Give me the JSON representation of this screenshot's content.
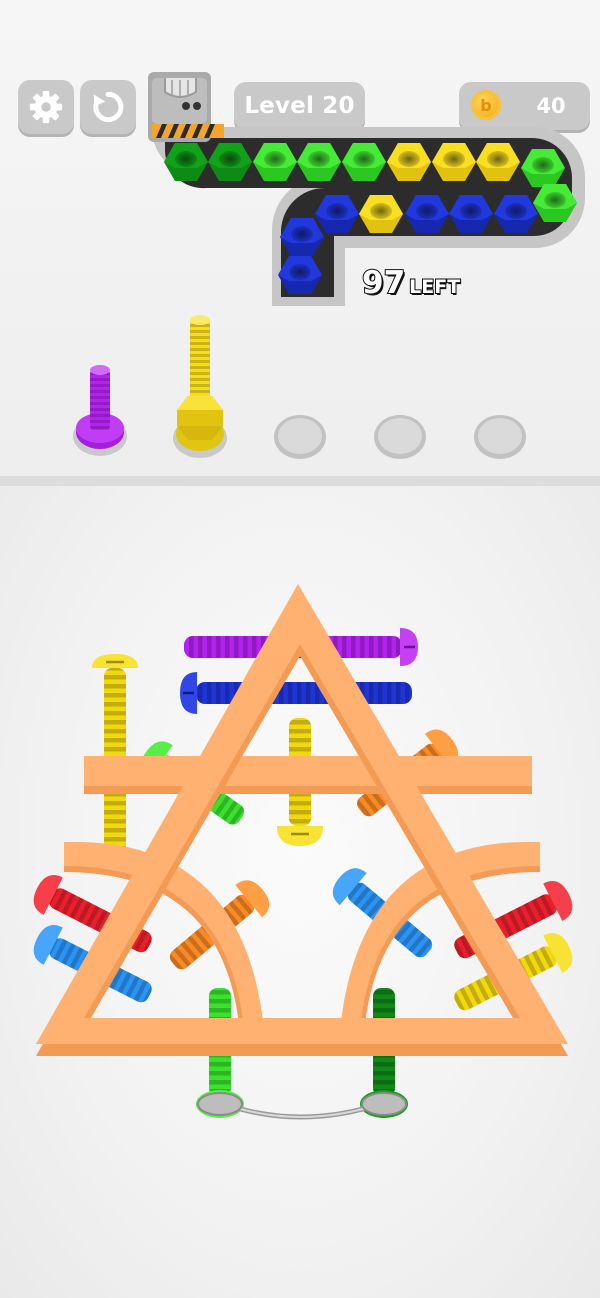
{
  "hud": {
    "settings_icon": "gear-icon",
    "restart_icon": "restart-icon",
    "level_label": "Level 20",
    "coin_icon": "coin-icon",
    "coin_glyph": "b",
    "coin_count": "40"
  },
  "conveyor": {
    "remaining_count": "97",
    "remaining_label": "LEFT",
    "nut_colors_order": [
      "dark-green",
      "dark-green",
      "green",
      "green",
      "green",
      "yellow",
      "yellow",
      "yellow",
      "green",
      "green",
      "blue",
      "blue",
      "blue",
      "yellow",
      "blue",
      "blue",
      "blue"
    ]
  },
  "slots": [
    {
      "state": "filled",
      "bolt_color": "purple"
    },
    {
      "state": "filled",
      "bolt_color": "yellow",
      "nuts": 1
    },
    {
      "state": "empty"
    },
    {
      "state": "empty"
    },
    {
      "state": "empty"
    }
  ],
  "colors": {
    "purple": "#b322f0",
    "yellow": "#f7dc1b",
    "green": "#39e62b",
    "dark_green": "#0f8a16",
    "blue": "#1f35d9",
    "light_blue": "#2a93f5",
    "red": "#ea1f2c",
    "orange": "#fb8a25",
    "frame": "#ffb171",
    "frame_shade": "#f49b56",
    "tray": "#c9c9c9"
  },
  "board": {
    "frame_parts": [
      "triangle-frame",
      "horizontal-bar",
      "left-arch",
      "right-arch"
    ],
    "bolt_colors": [
      "purple",
      "blue",
      "yellow",
      "green",
      "orange",
      "yellow",
      "green",
      "orange",
      "red",
      "light-blue",
      "orange",
      "light-blue",
      "red",
      "light-blue",
      "yellow",
      "green",
      "dark-green"
    ]
  }
}
